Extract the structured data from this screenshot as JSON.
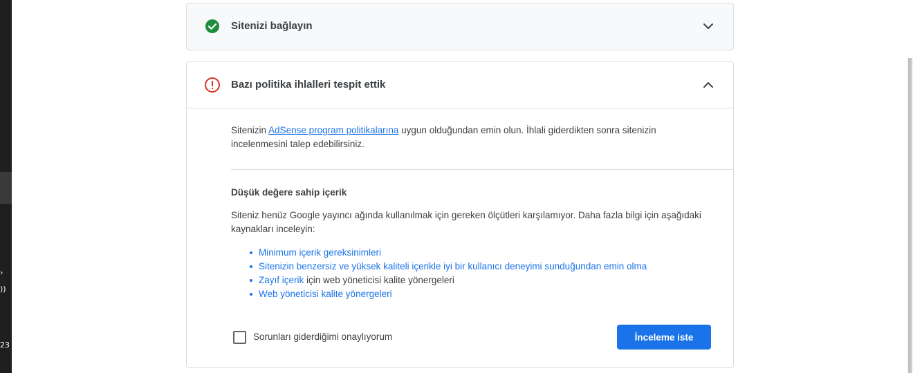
{
  "taskbar": {
    "chevron_glyph": "›",
    "wifi_glyph": "))",
    "clock_fragment": "23"
  },
  "connect_card": {
    "title": "Sitenizi bağlayın",
    "status_icon": "check-circle-icon",
    "status_color": "#1e8e3e",
    "state": "collapsed"
  },
  "policy_card": {
    "title": "Bazı politika ihlalleri tespit ettik",
    "status_icon": "error-outline-icon",
    "status_color": "#d93025",
    "state": "expanded",
    "intro": {
      "before": "Sitenizin ",
      "link": "AdSense program politikalarına",
      "after": " uygun olduğundan emin olun. İhlali giderdikten sonra sitenizin incelenmesini talep edebilirsiniz."
    },
    "section_title": "Düşük değere sahip içerik",
    "section_body": "Siteniz henüz Google yayıncı ağında kullanılmak için gereken ölçütleri karşılamıyor. Daha fazla bilgi için aşağıdaki kaynakları inceleyin:",
    "resources": [
      {
        "link": "Minimum içerik gereksinimleri",
        "suffix": ""
      },
      {
        "link": "Sitenizin benzersiz ve yüksek kaliteli içerikle iyi bir kullanıcı deneyimi sunduğundan emin olma",
        "suffix": ""
      },
      {
        "link": "Zayıf içerik",
        "suffix": " için web yöneticisi kalite yönergeleri"
      },
      {
        "link": "Web yöneticisi kalite yönergeleri",
        "suffix": ""
      }
    ],
    "checkbox_label": "Sorunları giderdiğimi onaylıyorum",
    "checkbox_checked": false,
    "button_label": "İnceleme iste"
  },
  "colors": {
    "accent": "#1a73e8",
    "border": "#dadce0",
    "text": "#3c4043"
  }
}
